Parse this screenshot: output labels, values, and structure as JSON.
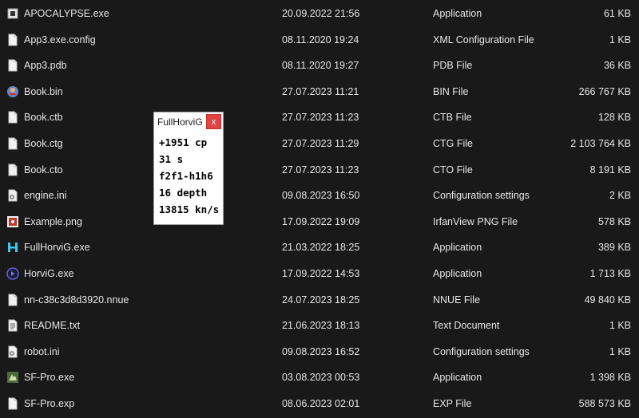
{
  "files": [
    {
      "name": "APOCALYPSE.exe",
      "date": "20.09.2022 21:56",
      "type": "Application",
      "size": "61 KB",
      "icon": "app-exe-icon"
    },
    {
      "name": "App3.exe.config",
      "date": "08.11.2020 19:24",
      "type": "XML Configuration File",
      "size": "1 KB",
      "icon": "document-icon"
    },
    {
      "name": "App3.pdb",
      "date": "08.11.2020 19:27",
      "type": "PDB File",
      "size": "36 KB",
      "icon": "document-icon"
    },
    {
      "name": "Book.bin",
      "date": "27.07.2023 11:21",
      "type": "BIN File",
      "size": "266 767 KB",
      "icon": "bin-file-icon"
    },
    {
      "name": "Book.ctb",
      "date": "27.07.2023 11:23",
      "type": "CTB File",
      "size": "128 KB",
      "icon": "document-icon"
    },
    {
      "name": "Book.ctg",
      "date": "27.07.2023 11:29",
      "type": "CTG File",
      "size": "2 103 764 KB",
      "icon": "document-icon"
    },
    {
      "name": "Book.cto",
      "date": "27.07.2023 11:23",
      "type": "CTO File",
      "size": "8 191 KB",
      "icon": "document-icon"
    },
    {
      "name": "engine.ini",
      "date": "09.08.2023 16:50",
      "type": "Configuration settings",
      "size": "2 KB",
      "icon": "settings-file-icon"
    },
    {
      "name": "Example.png",
      "date": "17.09.2022 19:09",
      "type": "IrfanView PNG File",
      "size": "578 KB",
      "icon": "image-file-icon"
    },
    {
      "name": "FullHorviG.exe",
      "date": "21.03.2022 18:25",
      "type": "Application",
      "size": "389 KB",
      "icon": "h-app-icon"
    },
    {
      "name": "HorviG.exe",
      "date": "17.09.2022 14:53",
      "type": "Application",
      "size": "1 713 KB",
      "icon": "horvig-app-icon"
    },
    {
      "name": "nn-c38c3d8d3920.nnue",
      "date": "24.07.2023 18:25",
      "type": "NNUE File",
      "size": "49 840 KB",
      "icon": "document-icon"
    },
    {
      "name": "README.txt",
      "date": "21.06.2023 18:13",
      "type": "Text Document",
      "size": "1 KB",
      "icon": "text-file-icon"
    },
    {
      "name": "robot.ini",
      "date": "09.08.2023 16:52",
      "type": "Configuration settings",
      "size": "1 KB",
      "icon": "settings-file-icon"
    },
    {
      "name": "SF-Pro.exe",
      "date": "03.08.2023 00:53",
      "type": "Application",
      "size": "1 398 KB",
      "icon": "sf-app-icon"
    },
    {
      "name": "SF-Pro.exp",
      "date": "08.06.2023 02:01",
      "type": "EXP File",
      "size": "588 573 KB",
      "icon": "document-icon"
    }
  ],
  "popup": {
    "title": "FullHorviG",
    "close_label": "x",
    "lines": [
      "+1951 cp",
      "31 s",
      "f2f1-h1h6",
      "16 depth",
      "13815 kn/s"
    ]
  },
  "colors": {
    "background": "#191919",
    "text": "#e6e6e6",
    "close_button": "#e04343"
  }
}
